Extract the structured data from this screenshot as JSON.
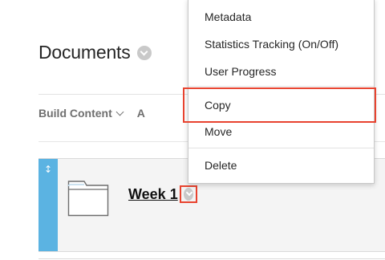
{
  "page": {
    "title": "Documents"
  },
  "toolbar": {
    "build_content_label": "Build Content",
    "next_partial": "A"
  },
  "item": {
    "title": "Week 1",
    "drag_handle_glyph": "↕"
  },
  "context_menu": {
    "items": [
      {
        "label": "Metadata"
      },
      {
        "label": "Statistics Tracking (On/Off)"
      },
      {
        "label": "User Progress"
      },
      {
        "label": "Copy"
      },
      {
        "label": "Move"
      },
      {
        "label": "Delete"
      }
    ]
  },
  "colors": {
    "accent_blue": "#5bb3e2",
    "highlight_red": "#e8432f",
    "icon_gray": "#c9c9c9"
  },
  "icons": {
    "title_menu": "chevron-down-circle-icon",
    "item_menu": "chevron-down-circle-icon",
    "folder": "folder-icon",
    "drag": "drag-handle-icon"
  }
}
